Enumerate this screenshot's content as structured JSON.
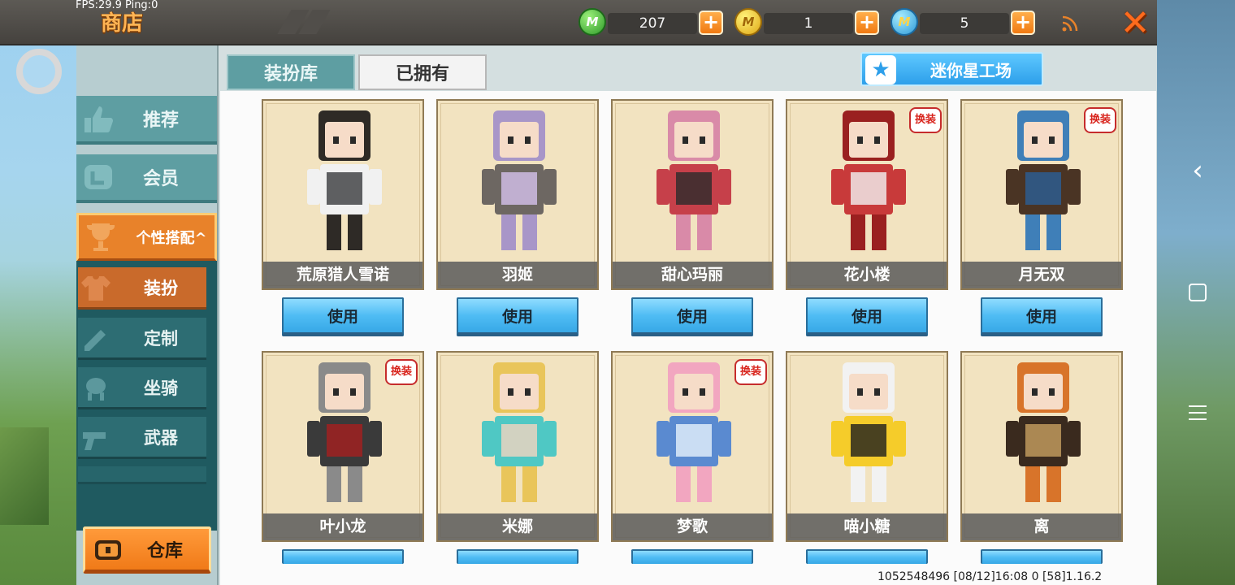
{
  "hud": {
    "fps": "FPS:29.9  Ping:0"
  },
  "header": {
    "title": "商店"
  },
  "currencies": [
    {
      "value": "207",
      "coin_icon": "green-gem-icon"
    },
    {
      "value": "1",
      "coin_icon": "gold-coin-icon"
    },
    {
      "value": "5",
      "coin_icon": "blue-coin-icon"
    }
  ],
  "sidebar": {
    "items": [
      {
        "label": "推荐"
      },
      {
        "label": "会员"
      },
      {
        "label": "个性搭配^"
      }
    ],
    "sub_items": [
      {
        "label": "装扮"
      },
      {
        "label": "定制"
      },
      {
        "label": "坐骑"
      },
      {
        "label": "武器"
      }
    ],
    "warehouse": "仓库"
  },
  "tabs": [
    {
      "label": "装扮库",
      "active": true
    },
    {
      "label": "已拥有",
      "active": false
    }
  ],
  "studio_button": "迷你星工场",
  "skins": [
    {
      "name": "荒原猎人雪诺",
      "badge": ""
    },
    {
      "name": "羽姬",
      "badge": ""
    },
    {
      "name": "甜心玛丽",
      "badge": ""
    },
    {
      "name": "花小楼",
      "badge": "换装"
    },
    {
      "name": "月无双",
      "badge": "换装"
    },
    {
      "name": "叶小龙",
      "badge": "换装"
    },
    {
      "name": "米娜",
      "badge": ""
    },
    {
      "name": "梦歌",
      "badge": "换装"
    },
    {
      "name": "喵小糖",
      "badge": ""
    },
    {
      "name": "离",
      "badge": ""
    }
  ],
  "use_label": "使用",
  "footer": {
    "info": "1052548496  [08/12]16:08 0  [58]1.16.2"
  },
  "colors": {
    "accent_orange": "#e8822a",
    "teal": "#5e9ea2",
    "use_blue": "#4fbcf4"
  }
}
